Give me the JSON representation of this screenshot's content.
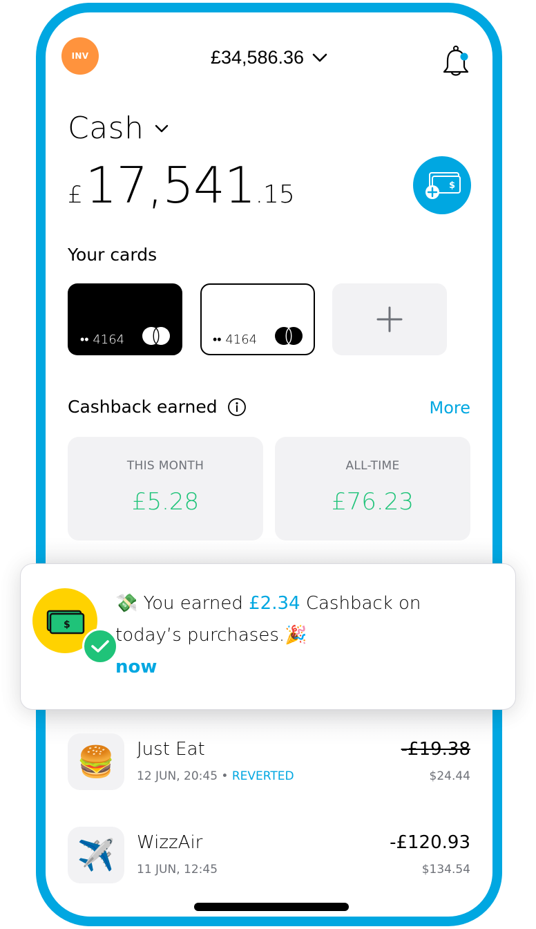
{
  "header": {
    "avatar_label": "INV",
    "total_balance": "£34,586.36",
    "notification_dot_color": "#00A7E1"
  },
  "account": {
    "name": "Cash",
    "balance_currency": "£",
    "balance_integer": "17,541",
    "balance_decimal": ".15"
  },
  "cards": {
    "title": "Your cards",
    "items": [
      {
        "style": "black",
        "masked_number": "•• 4164",
        "brand": "mastercard"
      },
      {
        "style": "white",
        "masked_number": "•• 4164",
        "brand": "mastercard"
      }
    ],
    "add_label": "+"
  },
  "cashback": {
    "title": "Cashback earned",
    "more_label": "More",
    "boxes": [
      {
        "label": "THIS MONTH",
        "value": "£5.28"
      },
      {
        "label": "ALL-TIME",
        "value": "£76.23"
      }
    ]
  },
  "toast": {
    "emoji_lead": "💸",
    "text_before": " You earned ",
    "amount": "£2.34",
    "text_after": " Cashback on today’s purchases.",
    "emoji_trail": "🎉",
    "time": "now"
  },
  "transactions": [
    {
      "icon": "🍔",
      "name": "Just Eat",
      "date": "12 JUN, 20:45",
      "separator": " • ",
      "status": "REVERTED",
      "amount": "-£19.38",
      "amount_struck": true,
      "original_amount": "$24.44"
    },
    {
      "icon": "✈️",
      "name": "WizzAir",
      "date": "11 JUN, 12:45",
      "amount": "-£120.93",
      "amount_struck": false,
      "original_amount": "$134.54"
    }
  ],
  "colors": {
    "accent": "#00A7E1",
    "positive": "#1FC379",
    "avatar": "#FF933D",
    "muted_text": "#6E7178",
    "surface": "#F2F2F4"
  }
}
